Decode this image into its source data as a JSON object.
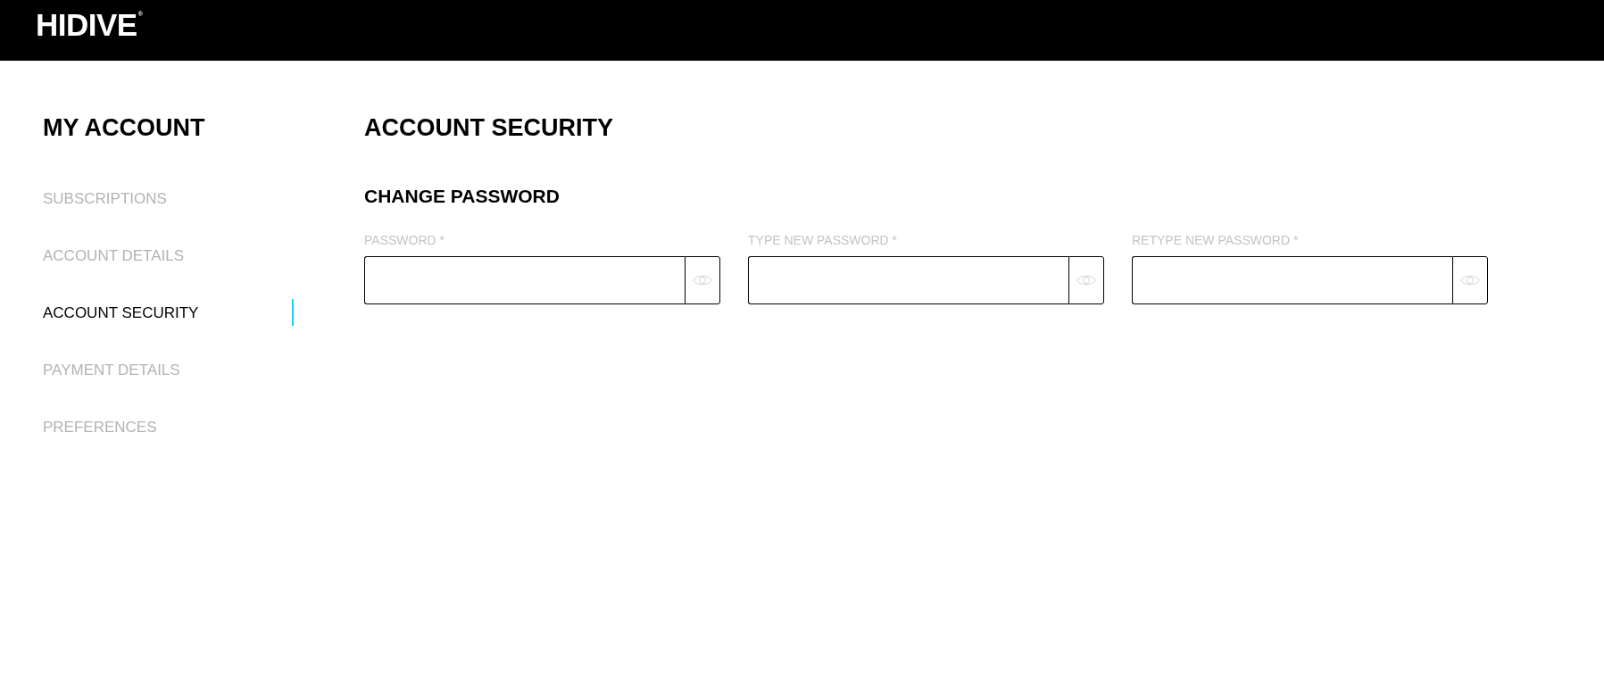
{
  "header": {
    "logo": "HIDIVE",
    "logo_mark": "®"
  },
  "sidebar": {
    "title": "MY ACCOUNT",
    "items": [
      {
        "label": "SUBSCRIPTIONS",
        "selected": false
      },
      {
        "label": "ACCOUNT DETAILS",
        "selected": false
      },
      {
        "label": "ACCOUNT SECURITY",
        "selected": true
      },
      {
        "label": "PAYMENT DETAILS",
        "selected": false
      },
      {
        "label": "PREFERENCES",
        "selected": false
      }
    ]
  },
  "main": {
    "title": "ACCOUNT SECURITY",
    "section": {
      "title": "CHANGE PASSWORD",
      "fields": [
        {
          "label": "PASSWORD *"
        },
        {
          "label": "TYPE NEW PASSWORD *"
        },
        {
          "label": "RETYPE NEW PASSWORD *"
        }
      ]
    }
  }
}
